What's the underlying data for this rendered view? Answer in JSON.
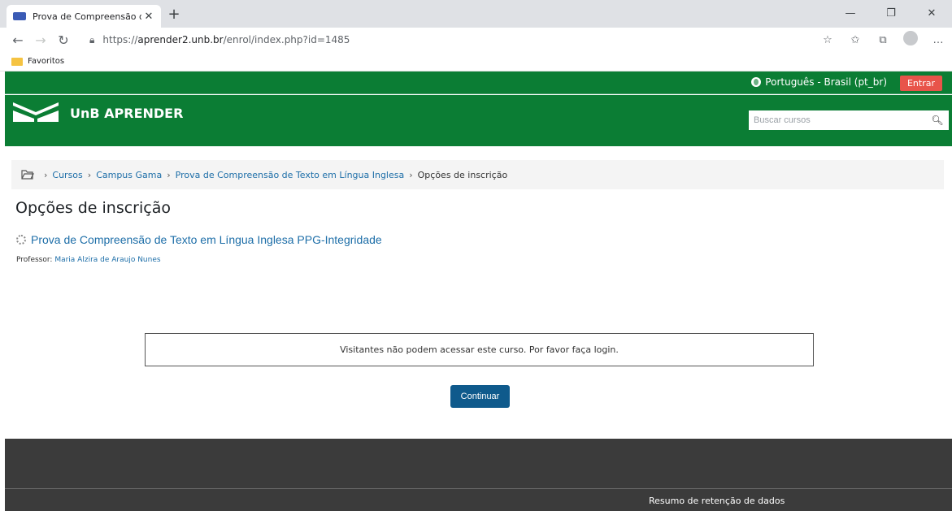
{
  "browser": {
    "tab_title": "Prova de Compreensão de Texto",
    "tab_close": "✕",
    "new_tab": "+",
    "url_prefix": "https://",
    "url_host": "aprender2.unb.br",
    "url_path": "/enrol/index.php?id=1485",
    "favorites_label": "Favoritos",
    "window_minimize": "—",
    "window_maximize": "❐",
    "window_close": "✕",
    "more_menu": "…"
  },
  "header": {
    "language": "Português - Brasil (pt_br)",
    "login_label": "Entrar",
    "brand_name": "UnB APRENDER",
    "search_placeholder": "Buscar cursos",
    "brand_color": "#0b7d34",
    "login_color": "#e8544a"
  },
  "breadcrumb": {
    "items": [
      "Cursos",
      "Campus Gama",
      "Prova de Compreensão de Texto em Língua Inglesa"
    ],
    "current": "Opções de inscrição",
    "separator": "›"
  },
  "main": {
    "page_title": "Opções de inscrição",
    "course_name": "Prova de Compreensão de Texto em Língua Inglesa PPG-Integridade",
    "teacher_label": "Professor:",
    "teacher_name": "Maria Alzira de Araujo Nunes",
    "notice": "Visitantes não podem acessar este curso. Por favor faça login.",
    "continue_label": "Continuar"
  },
  "footer": {
    "data_retention_link": "Resumo de retenção de dados"
  }
}
